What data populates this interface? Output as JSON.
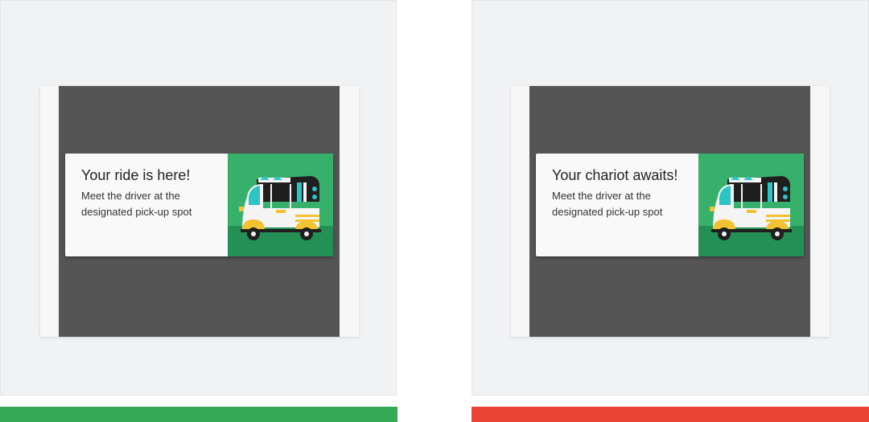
{
  "panels": [
    {
      "variant": "do",
      "status_color": "#35a853",
      "card": {
        "title": "Your ride is here!",
        "body": "Meet the driver at the designated pick-up spot",
        "illustration": "auto-rickshaw-illustration"
      }
    },
    {
      "variant": "dont",
      "status_color": "#ea4335",
      "card": {
        "title": "Your chariot awaits!",
        "body": "Meet the driver at the designated pick-up spot",
        "illustration": "auto-rickshaw-illustration"
      }
    }
  ],
  "colors": {
    "card_image_bg": "#37b06c",
    "card_image_ground": "#259055",
    "scrim": "#555555"
  }
}
